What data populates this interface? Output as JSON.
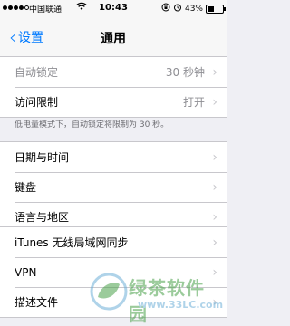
{
  "status_bar": {
    "carrier": "中国联通",
    "time": "10:43",
    "battery_percent": "43%",
    "battery_level": 0.43,
    "signal_bars": 4
  },
  "nav": {
    "back_label": "设置",
    "title": "通用"
  },
  "group1": [
    {
      "label": "自动锁定",
      "value": "30 秒钟",
      "dim": true
    },
    {
      "label": "访问限制",
      "value": "打开",
      "dim": false
    }
  ],
  "group1_footer": "低电量模式下，自动锁定将限制为 30 秒。",
  "group2": [
    {
      "label": "日期与时间"
    },
    {
      "label": "键盘"
    },
    {
      "label": "语言与地区"
    }
  ],
  "group3": [
    {
      "label": "iTunes 无线局域网同步"
    },
    {
      "label": "VPN"
    },
    {
      "label": "描述文件"
    }
  ],
  "watermark": {
    "text": "绿茶软件园",
    "url": "www.33LC.com"
  },
  "colors": {
    "accent": "#007aff",
    "background": "#efeff4",
    "separator": "#c8c7cc",
    "secondary_text": "#8e8e93"
  }
}
